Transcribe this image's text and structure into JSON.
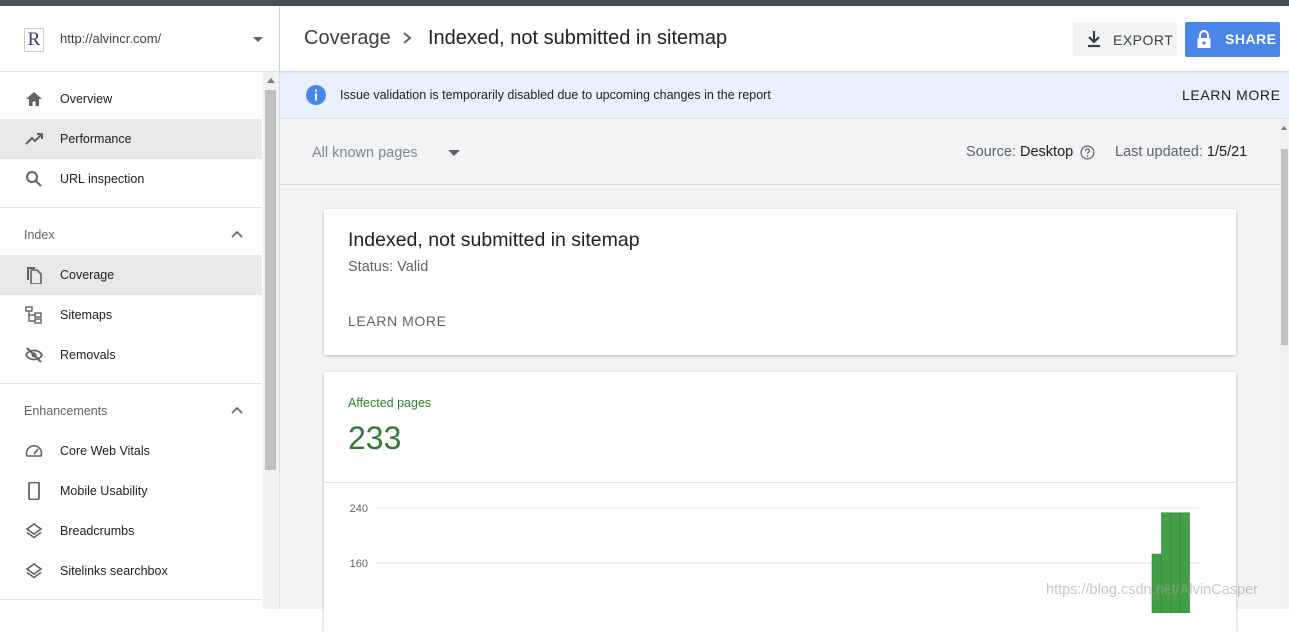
{
  "property": {
    "url": "http://alvincr.com/",
    "logo_letter": "R"
  },
  "sidebar": {
    "top_items": [
      {
        "label": "Overview",
        "icon": "home-icon"
      },
      {
        "label": "Performance",
        "icon": "trending-up-icon"
      },
      {
        "label": "URL inspection",
        "icon": "search-icon"
      }
    ],
    "index_section": {
      "title": "Index",
      "items": [
        {
          "label": "Coverage",
          "icon": "copy-pages-icon"
        },
        {
          "label": "Sitemaps",
          "icon": "sitemap-icon"
        },
        {
          "label": "Removals",
          "icon": "eye-off-icon"
        }
      ]
    },
    "enhancements_section": {
      "title": "Enhancements",
      "items": [
        {
          "label": "Core Web Vitals",
          "icon": "speedometer-icon"
        },
        {
          "label": "Mobile Usability",
          "icon": "smartphone-icon"
        },
        {
          "label": "Breadcrumbs",
          "icon": "layers-icon"
        },
        {
          "label": "Sitelinks searchbox",
          "icon": "layers-icon"
        }
      ]
    }
  },
  "header": {
    "breadcrumb_root": "Coverage",
    "breadcrumb_current": "Indexed, not submitted in sitemap",
    "export_label": "EXPORT",
    "share_label": "SHARE"
  },
  "banner": {
    "text": "Issue validation is temporarily disabled due to upcoming changes in the report",
    "learn_more": "LEARN MORE"
  },
  "filter": {
    "selected": "All known pages",
    "source_label": "Source:",
    "source_value": "Desktop",
    "updated_label": "Last updated:",
    "updated_value": "1/5/21"
  },
  "status_card": {
    "title": "Indexed, not submitted in sitemap",
    "status": "Status: Valid",
    "learn_more": "LEARN MORE"
  },
  "affected_card": {
    "label": "Affected pages",
    "count": "233"
  },
  "chart_data": {
    "type": "bar",
    "y_ticks": [
      "240",
      "160"
    ],
    "values_visible": [
      173,
      233,
      233,
      233
    ],
    "color": "#43a047"
  },
  "watermark": "https://blog.csdn.net/AlvinCasper",
  "colors": {
    "accent": "#4a86e8",
    "valid_green": "#2e7d32",
    "banner_bg": "#e8f0fe"
  }
}
